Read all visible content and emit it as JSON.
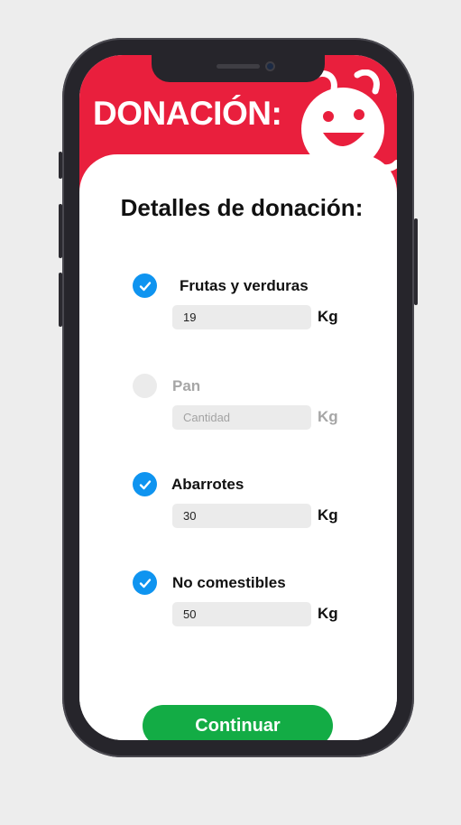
{
  "header": {
    "title": "DONACIÓN:"
  },
  "card": {
    "title": "Detalles de donación:"
  },
  "items": [
    {
      "label": "Frutas y verduras",
      "checked": true,
      "value": "19",
      "placeholder": "Cantidad",
      "unit": "Kg"
    },
    {
      "label": "Pan",
      "checked": false,
      "value": "",
      "placeholder": "Cantidad",
      "unit": "Kg"
    },
    {
      "label": "Abarrotes",
      "checked": true,
      "value": "30",
      "placeholder": "Cantidad",
      "unit": "Kg"
    },
    {
      "label": "No comestibles",
      "checked": true,
      "value": "50",
      "placeholder": "Cantidad",
      "unit": "Kg"
    }
  ],
  "cta": {
    "label": "Continuar"
  },
  "colors": {
    "brand": "#e91f3d",
    "check": "#0f94f0",
    "cta": "#13ac45",
    "field": "#ebebeb"
  },
  "icons": {
    "check": "checkmark-icon",
    "mascot": "smiling-mascot-logo"
  }
}
